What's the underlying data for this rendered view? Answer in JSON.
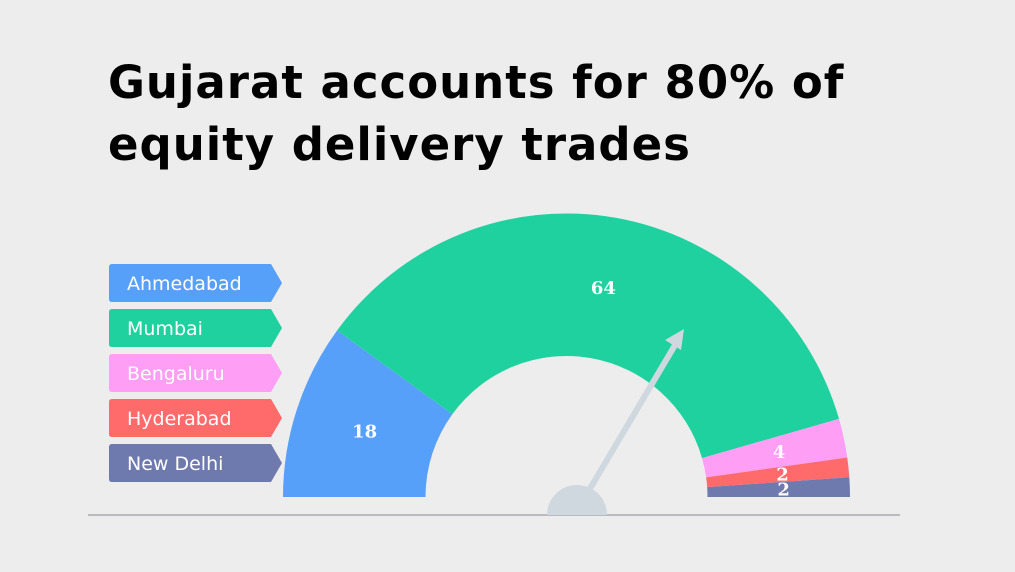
{
  "chart_data": {
    "type": "gauge",
    "title": "Gujarat accounts for 80% of equity delivery trades",
    "categories": [
      "Ahmedabad",
      "Mumbai",
      "Bengaluru",
      "Hyderabad",
      "New Delhi"
    ],
    "values": [
      18,
      64,
      4,
      2,
      2
    ],
    "colors": [
      "#56a0fa",
      "#20d1a0",
      "#ff9ef5",
      "#ff6b6b",
      "#6e79ae"
    ],
    "legend_placement": "left",
    "needle_color": "#d0d8df"
  }
}
